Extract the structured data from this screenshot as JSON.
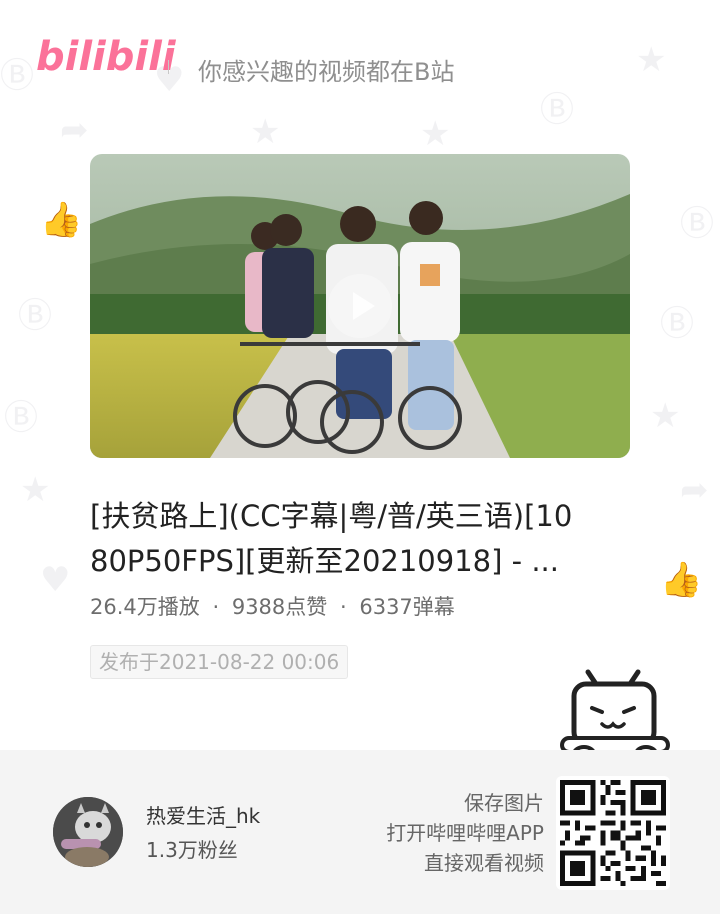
{
  "header": {
    "logo": "bilibili",
    "slogan": "你感兴趣的视频都在B站"
  },
  "video": {
    "title": "[扶贫路上](CC字幕|粤/普/英三语)[1080P50FPS][更新至20210918] - ...",
    "title_line1": "[扶贫路上](CC字幕|粤/普/英三语)[10",
    "title_line2": "80P50FPS][更新至20210918] - ...",
    "views": "26.4万播放",
    "likes": "9388点赞",
    "danmaku": "6337弹幕",
    "separator": "·",
    "published": "发布于2021-08-22 00:06"
  },
  "uploader": {
    "name": "热爱生活_hk",
    "fans": "1.3万粉丝"
  },
  "cta": {
    "line1": "保存图片",
    "line2": "打开哔哩哔哩APP",
    "line3": "直接观看视频"
  },
  "colors": {
    "brand": "#fb7299",
    "footer_bg": "#f4f4f4"
  },
  "icons": {
    "play": "play-icon",
    "mascot": "tv-mascot-icon",
    "qr": "qr-code-icon"
  }
}
